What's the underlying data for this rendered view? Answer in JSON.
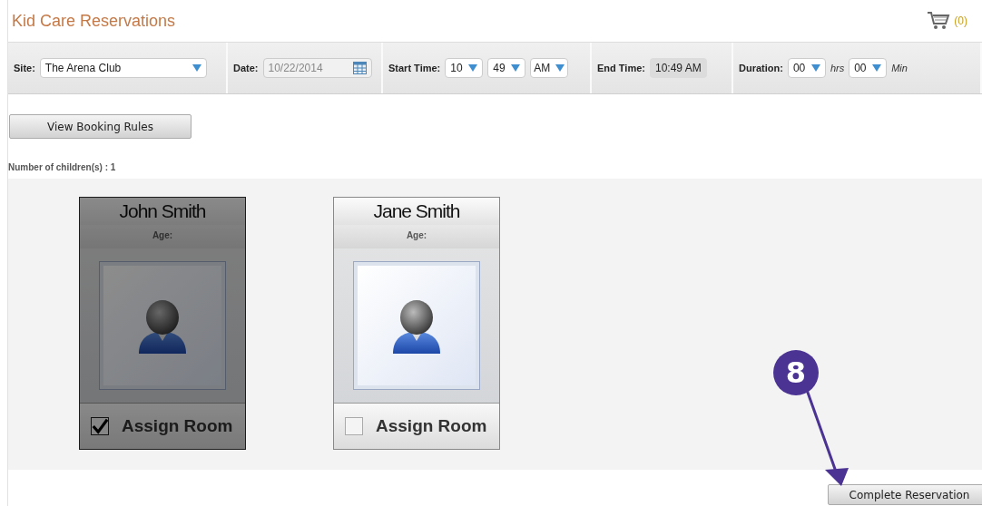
{
  "header": {
    "title": "Kid Care Reservations",
    "cart_count": "(0)"
  },
  "toolbar": {
    "site": {
      "label": "Site:",
      "value": "The Arena Club"
    },
    "date": {
      "label": "Date:",
      "value": "10/22/2014"
    },
    "start_time": {
      "label": "Start Time:",
      "hour": "10",
      "minute": "49",
      "meridiem": "AM"
    },
    "end_time": {
      "label": "End Time:",
      "value": "10:49 AM"
    },
    "duration": {
      "label": "Duration:",
      "hours": "00",
      "hours_unit": "hrs",
      "minutes": "00",
      "minutes_unit": "Min"
    }
  },
  "view_rules_button": "View Booking Rules",
  "children_count": {
    "label": "Number of children(s) :",
    "value": "1"
  },
  "children": [
    {
      "name": "John Smith",
      "age_label": "Age:",
      "checkbox_label": "Assign Room",
      "checked": true
    },
    {
      "name": "Jane Smith",
      "age_label": "Age:",
      "checkbox_label": "Assign Room",
      "checked": false
    }
  ],
  "callout": "8",
  "complete_button": "Complete Reservation"
}
